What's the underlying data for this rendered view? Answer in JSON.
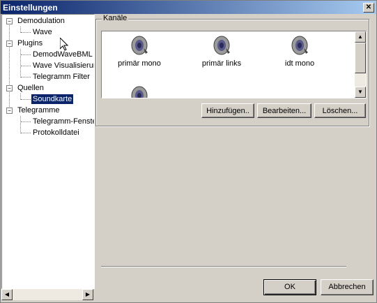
{
  "window": {
    "title": "Einstellungen",
    "close_glyph": "✕"
  },
  "tree": {
    "groups": [
      {
        "label": "Demodulation",
        "children": [
          "Wave"
        ]
      },
      {
        "label": "Plugins",
        "children": [
          "DemodWaveBML",
          "Wave Visualisierung",
          "Telegramm Filter"
        ]
      },
      {
        "label": "Quellen",
        "children": [
          "Soundkarte"
        ]
      },
      {
        "label": "Telegramme",
        "children": [
          "Telegramm-Fenster",
          "Protokolldatei"
        ]
      }
    ],
    "selected": "Soundkarte",
    "expander_glyph": "−"
  },
  "channels": {
    "legend": "Kanäle",
    "items": [
      {
        "label": "primär mono",
        "icon": "speaker-icon"
      },
      {
        "label": "primär links",
        "icon": "speaker-icon"
      },
      {
        "label": "idt mono",
        "icon": "speaker-icon"
      },
      {
        "label": "",
        "icon": "speaker-icon"
      }
    ],
    "add_label": "Hinzufügen..",
    "edit_label": "Bearbeiten...",
    "delete_label": "Löschen..."
  },
  "footer": {
    "ok_label": "OK",
    "cancel_label": "Abbrechen"
  },
  "colors": {
    "title_start": "#0a246a",
    "title_end": "#a6caf0",
    "face": "#d4d0c8",
    "selection": "#0a246a"
  }
}
